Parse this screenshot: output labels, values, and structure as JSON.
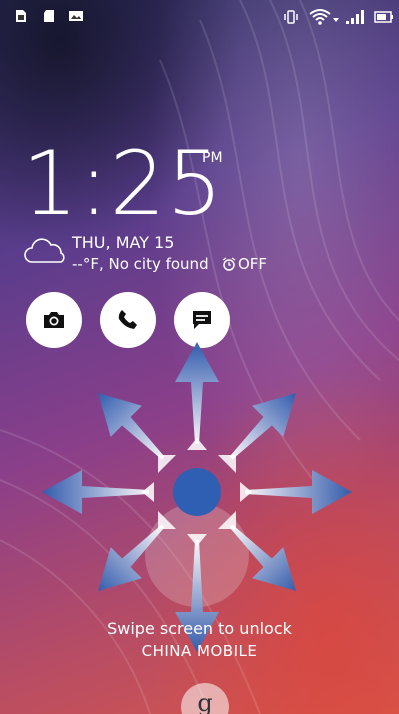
{
  "status_bar": {
    "left_icons": [
      "sim-card-icon",
      "sd-card-icon",
      "image-icon"
    ],
    "right_icons": [
      "vibrate-icon",
      "wifi-icon",
      "signal-icon",
      "battery-icon"
    ]
  },
  "lockscreen": {
    "time": "1:25",
    "ampm": "PM",
    "date": "THU, MAY 15",
    "weather": "--°F, No city found",
    "alarm": "OFF",
    "weather_icon": "cloud-icon",
    "alarm_icon": "alarm-clock-icon"
  },
  "shortcuts": [
    {
      "name": "camera",
      "icon": "camera-icon"
    },
    {
      "name": "phone",
      "icon": "phone-icon"
    },
    {
      "name": "messages",
      "icon": "message-icon"
    }
  ],
  "unlock_hint": "Swipe screen to unlock",
  "carrier": "CHINA  MOBILE",
  "google_button": "g",
  "colors": {
    "text": "#ffffff",
    "arrow": "#3a6fc0",
    "center": "#2f5fb3"
  }
}
